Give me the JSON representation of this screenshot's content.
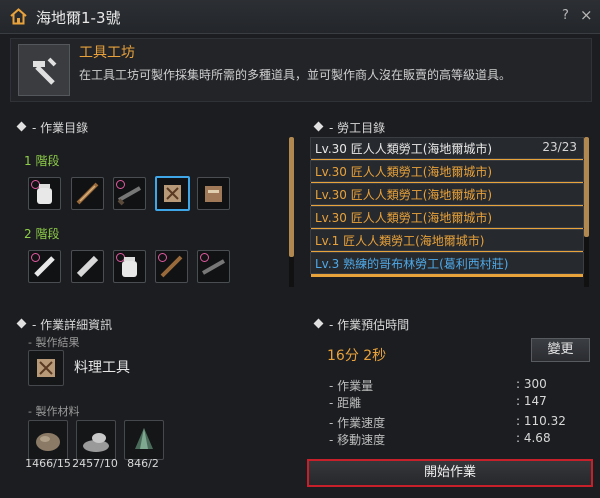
{
  "window": {
    "title": "海地爾1-3號",
    "help": "?",
    "close": "×"
  },
  "header": {
    "title": "工具工坊",
    "description": "在工具工坊可製作採集時所需的多種道具，並可製作商人沒在販賣的高等級道具。"
  },
  "work_list": {
    "title": "- 作業目錄",
    "stage1": "1 階段",
    "stage2": "2 階段",
    "stage1_items": [
      "water-bottle-icon",
      "sword-icon",
      "rifle-icon",
      "hammer-tools-icon",
      "tool-box-icon"
    ],
    "stage2_items": [
      "tube-icon",
      "tube-icon",
      "water-bottle-icon",
      "sword-icon",
      "rifle-icon"
    ]
  },
  "workers": {
    "title": "- 勞工目錄",
    "count": "23/23",
    "items": [
      {
        "text": "Lv.30 匠人人類勞工(海地爾城市)",
        "color": "#e8e8e8",
        "level": 1.0
      },
      {
        "text": "Lv.30 匠人人類勞工(海地爾城市)",
        "color": "#e9a23b",
        "level": 1.0
      },
      {
        "text": "Lv.30 匠人人類勞工(海地爾城市)",
        "color": "#e9a23b",
        "level": 1.0
      },
      {
        "text": "Lv.30 匠人人類勞工(海地爾城市)",
        "color": "#e9a23b",
        "level": 1.0
      },
      {
        "text": "Lv.1 匠人人類勞工(海地爾城市)",
        "color": "#e9a23b",
        "level": 1.0
      },
      {
        "text": "Lv.3 熟練的哥布林勞工(葛利西村莊)",
        "color": "#4fa9e8",
        "level": 1.0
      }
    ]
  },
  "detail": {
    "title": "- 作業詳細資訊",
    "result_label": "- 製作結果",
    "result_name": "料理工具",
    "materials_label": "- 製作材料",
    "materials": [
      {
        "icon": "ore-icon",
        "count": "1466/15"
      },
      {
        "icon": "powder-icon",
        "count": "2457/10"
      },
      {
        "icon": "crystal-icon",
        "count": "846/2"
      }
    ]
  },
  "estimate": {
    "title": "- 作業預估時間",
    "time": "16分 2秒",
    "change_label": "變更",
    "stats": [
      {
        "k": "- 作業量",
        "v": ": 300"
      },
      {
        "k": "- 距離",
        "v": ": 147"
      },
      {
        "k": "- 作業速度",
        "v": ": 110.32"
      },
      {
        "k": "- 移動速度",
        "v": ": 4.68"
      }
    ]
  },
  "start_label": "開始作業"
}
